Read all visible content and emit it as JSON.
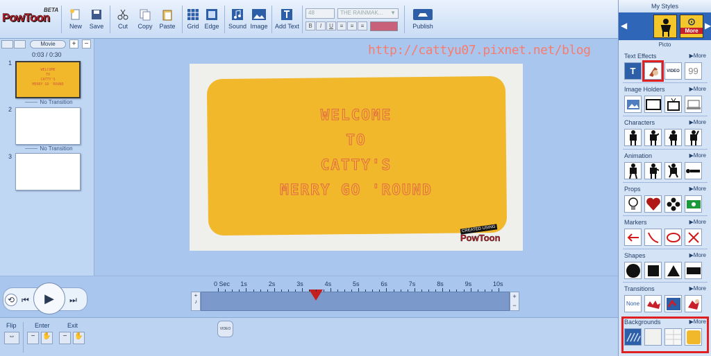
{
  "app": {
    "logo": "PowToon",
    "beta": "BETA"
  },
  "toolbar": {
    "new": "New",
    "save": "Save",
    "cut": "Cut",
    "copy": "Copy",
    "paste": "Paste",
    "grid": "Grid",
    "edge": "Edge",
    "sound": "Sound",
    "image": "Image",
    "add_text": "Add Text",
    "font_size": "48",
    "font_name": "THE RAINMAK...",
    "bold": "B",
    "italic": "I",
    "underline": "U",
    "publish": "Publish"
  },
  "leftpanel": {
    "mode_label": "Movie",
    "time": "0:03 / 0:30",
    "slides": [
      "1",
      "2",
      "3"
    ],
    "no_transition": "No Transition",
    "thumb_lines": [
      "WELCOME",
      "TO",
      "CATTY'S",
      "MERRY GO 'ROUND"
    ]
  },
  "stage": {
    "lines": [
      "WELCOME",
      "TO",
      "CATTY'S",
      "MERRY GO 'ROUND"
    ],
    "badge_top": "CREATED USING",
    "badge_logo": "PowToon"
  },
  "watermark": "http://cattyu07.pixnet.net/blog",
  "timeline": {
    "ticks": [
      "0 Sec",
      "1s",
      "2s",
      "3s",
      "4s",
      "5s",
      "6s",
      "7s",
      "8s",
      "9s",
      "10s"
    ],
    "playhead": "3.5s"
  },
  "bottom": {
    "flip": "Flip",
    "enter": "Enter",
    "exit": "Exit",
    "video_chip": "VIDEO"
  },
  "rightpanel": {
    "my_styles": "My Styles",
    "more": "More",
    "picto": "Picto",
    "sections": [
      {
        "title": "Text Effects",
        "more": "More"
      },
      {
        "title": "Image Holders",
        "more": "More"
      },
      {
        "title": "Characters",
        "more": "More"
      },
      {
        "title": "Animation",
        "more": "More"
      },
      {
        "title": "Props",
        "more": "More"
      },
      {
        "title": "Markers",
        "more": "More"
      },
      {
        "title": "Shapes",
        "more": "More"
      },
      {
        "title": "Transitions",
        "more": "More"
      },
      {
        "title": "Backgrounds",
        "more": "More"
      }
    ],
    "text_effect_items": [
      "T",
      "",
      "VIDEO",
      "99"
    ],
    "transition_items": [
      "None",
      "",
      "",
      ""
    ]
  },
  "colors": {
    "accent_red": "#e02020",
    "canvas_yellow": "#f0b82a",
    "panel_blue": "#a9c6ee"
  }
}
